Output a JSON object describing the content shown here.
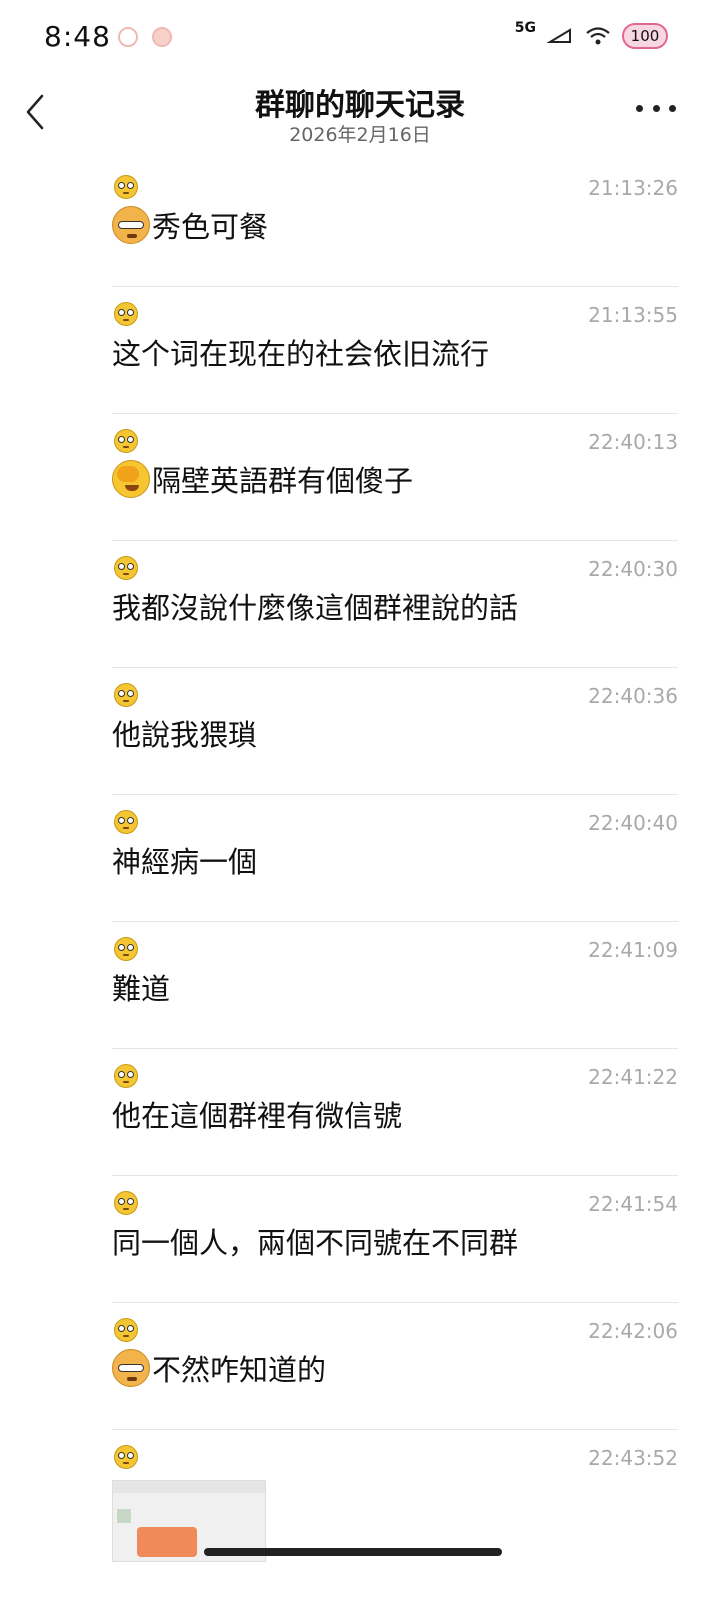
{
  "status_bar": {
    "time": "8:48",
    "network": "5G",
    "battery": "100"
  },
  "header": {
    "title": "群聊的聊天记录",
    "date": "2026年2月16日"
  },
  "messages": [
    {
      "time": "21:13:26",
      "emoji": "doge-emoji",
      "text": "秀色可餐"
    },
    {
      "time": "21:13:55",
      "emoji": "",
      "text": "这个词在现在的社会依旧流行"
    },
    {
      "time": "22:40:13",
      "emoji": "facepalm-emoji",
      "text": "隔壁英語群有個傻子"
    },
    {
      "time": "22:40:30",
      "emoji": "",
      "text": "我都沒說什麼像這個群裡說的話"
    },
    {
      "time": "22:40:36",
      "emoji": "",
      "text": "他說我猥瑣"
    },
    {
      "time": "22:40:40",
      "emoji": "",
      "text": "神經病一個"
    },
    {
      "time": "22:41:09",
      "emoji": "",
      "text": "難道"
    },
    {
      "time": "22:41:22",
      "emoji": "",
      "text": "他在這個群裡有微信號"
    },
    {
      "time": "22:41:54",
      "emoji": "",
      "text": "同一個人，兩個不同號在不同群"
    },
    {
      "time": "22:42:06",
      "emoji": "doge-emoji",
      "text": "不然咋知道的"
    },
    {
      "time": "22:43:52",
      "emoji": "",
      "text": "",
      "image": true
    }
  ]
}
